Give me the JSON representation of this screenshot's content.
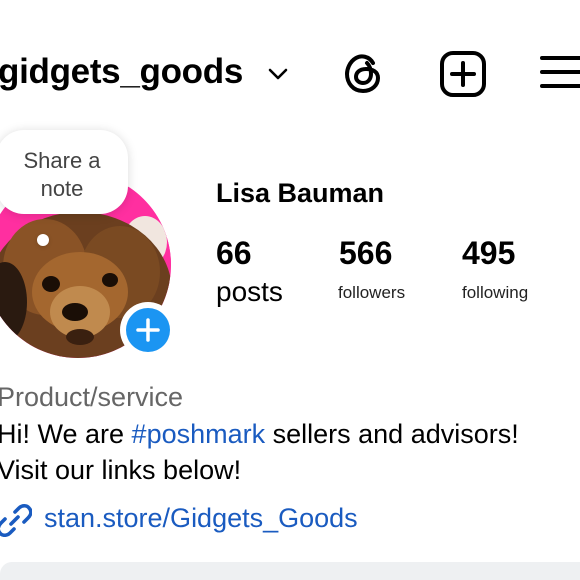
{
  "header": {
    "username": "gidgets_goods"
  },
  "note": {
    "text_line1": "Share a",
    "text_line2": "note"
  },
  "profile": {
    "full_name": "Lisa Bauman",
    "stats": {
      "posts_count": "66",
      "posts_label": "posts",
      "followers_count": "566",
      "followers_label": "followers",
      "following_count": "495",
      "following_label": "following"
    }
  },
  "bio": {
    "category": "Product/service",
    "line1_before": "Hi! We are ",
    "line1_hashtag": "#poshmark",
    "line1_after": " sellers and advisors!",
    "line2": "Visit our links below!",
    "link": "stan.store/Gidgets_Goods"
  },
  "colors": {
    "link_blue": "#1a5bc0",
    "add_button_blue": "#1b95f2",
    "avatar_pink": "#ff2fa0"
  },
  "icons": [
    "chevron-down-icon",
    "threads-icon",
    "new-post-icon",
    "menu-icon",
    "plus-icon",
    "link-icon"
  ]
}
